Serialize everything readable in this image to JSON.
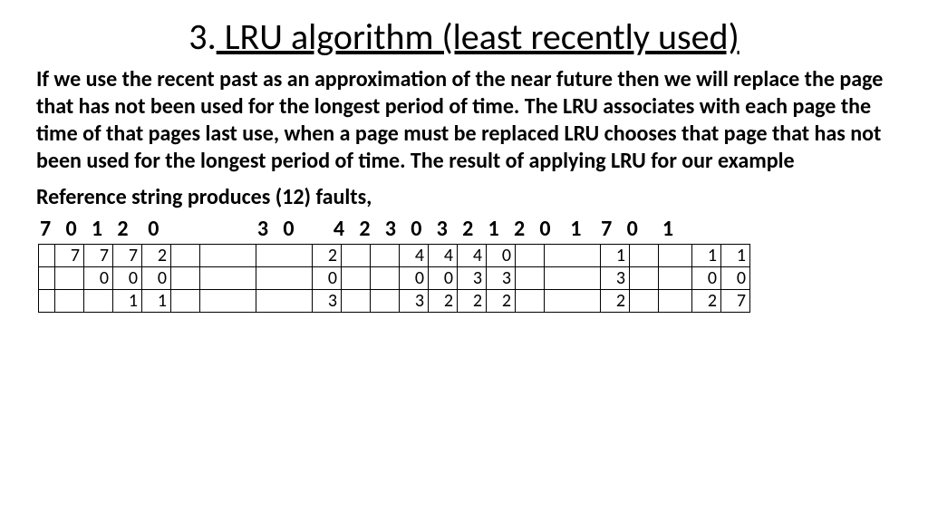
{
  "title_prefix": "3.",
  "title_main": " LRU algorithm (least recently used)",
  "paragraph": "If we use the recent past as an approximation of the near future then we will replace the page that has not been used for the longest period of time. The LRU associates with each page the time of that pages last use, when a page must be replaced LRU chooses that page that has not been used for the longest period of time. The result of applying LRU for our example",
  "faults_line": "Reference string produces (12) faults,",
  "reference_string": "7   0   1   2    0                    3   0        4   2   3   0   3   2   1   2   0    1    7   0     1",
  "chart_data": {
    "type": "table",
    "title": "LRU page replacement trace",
    "columns_are": "time steps (reference string positions)",
    "rows_are": "page frame slots (top=frame0, middle=frame1, bottom=frame2)",
    "reference_sequence": [
      7,
      0,
      1,
      2,
      0,
      3,
      0,
      4,
      2,
      3,
      0,
      3,
      2,
      1,
      2,
      0,
      1,
      7,
      0,
      1
    ],
    "fault_count": 12,
    "frames": 3,
    "grid": [
      [
        "",
        "7",
        "7",
        "7",
        "2",
        "",
        "",
        "",
        "2",
        "",
        "",
        "4",
        "4",
        "4",
        "0",
        "",
        "",
        "1",
        "",
        "",
        "1",
        "1"
      ],
      [
        "",
        "",
        "0",
        "0",
        "0",
        "",
        "",
        "",
        "0",
        "",
        "",
        "0",
        "0",
        "3",
        "3",
        "",
        "",
        "3",
        "",
        "",
        "0",
        "0"
      ],
      [
        "",
        "",
        "",
        "1",
        "1",
        "",
        "",
        "",
        "3",
        "",
        "",
        "3",
        "2",
        "2",
        "2",
        "",
        "",
        "2",
        "",
        "",
        "2",
        "7"
      ]
    ]
  }
}
